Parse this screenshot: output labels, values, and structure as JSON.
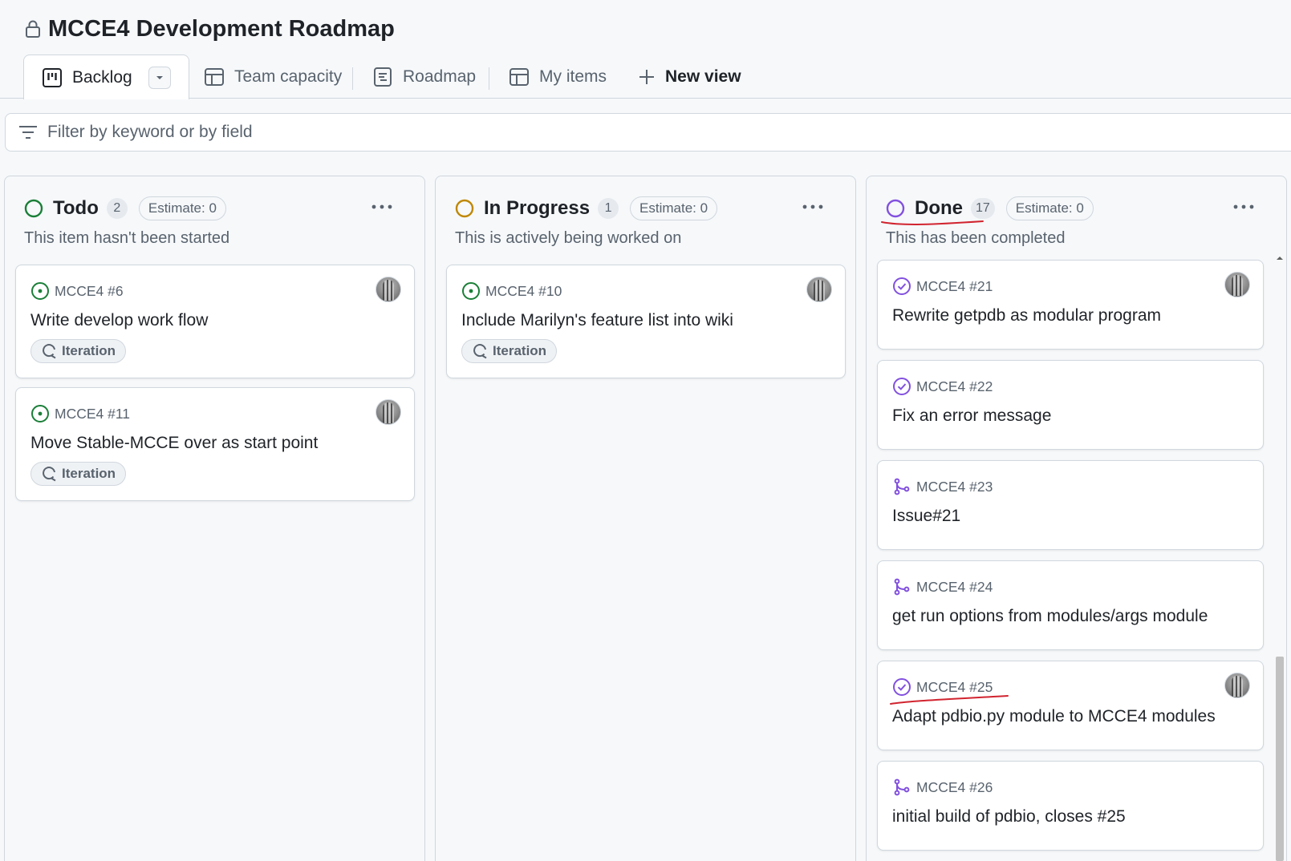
{
  "project": {
    "title": "MCCE4 Development Roadmap"
  },
  "tabs": [
    {
      "label": "Backlog",
      "icon": "board-icon",
      "active": true
    },
    {
      "label": "Team capacity",
      "icon": "table-icon"
    },
    {
      "label": "Roadmap",
      "icon": "roadmap-icon"
    },
    {
      "label": "My items",
      "icon": "table-icon"
    },
    {
      "label": "New view",
      "icon": "plus-icon"
    }
  ],
  "filter": {
    "placeholder": "Filter by keyword or by field",
    "value": ""
  },
  "colors": {
    "todo": "#1a7f37",
    "in_progress": "#bf8700",
    "done": "#8250df",
    "annotation": "#d1242f"
  },
  "columns": [
    {
      "name": "Todo",
      "count": "2",
      "estimate": "Estimate: 0",
      "description": "This item hasn't been started",
      "cards": [
        {
          "ref": "MCCE4 #6",
          "title": "Write develop work flow",
          "type": "issue-open",
          "avatar": true,
          "pill": "Iteration"
        },
        {
          "ref": "MCCE4 #11",
          "title": "Move Stable-MCCE over as start point",
          "type": "issue-open",
          "avatar": true,
          "pill": "Iteration"
        }
      ]
    },
    {
      "name": "In Progress",
      "count": "1",
      "estimate": "Estimate: 0",
      "description": "This is actively being worked on",
      "cards": [
        {
          "ref": "MCCE4 #10",
          "title": "Include Marilyn's feature list into wiki",
          "type": "issue-open",
          "avatar": true,
          "pill": "Iteration"
        }
      ]
    },
    {
      "name": "Done",
      "count": "17",
      "estimate": "Estimate: 0",
      "description": "This has been completed",
      "cards": [
        {
          "ref": "MCCE4 #21",
          "title": "Rewrite getpdb as modular program",
          "type": "issue-closed",
          "avatar": true
        },
        {
          "ref": "MCCE4 #22",
          "title": "Fix an error message",
          "type": "issue-closed",
          "avatar": false
        },
        {
          "ref": "MCCE4 #23",
          "title": "Issue#21",
          "type": "pr-merged",
          "avatar": false
        },
        {
          "ref": "MCCE4 #24",
          "title": "get run options from modules/args module",
          "type": "pr-merged",
          "avatar": false
        },
        {
          "ref": "MCCE4 #25",
          "title": "Adapt pdbio.py module to MCCE4 modules",
          "type": "issue-closed",
          "avatar": true
        },
        {
          "ref": "MCCE4 #26",
          "title": "initial build of pdbio, closes #25",
          "type": "pr-merged",
          "avatar": false
        }
      ]
    }
  ]
}
